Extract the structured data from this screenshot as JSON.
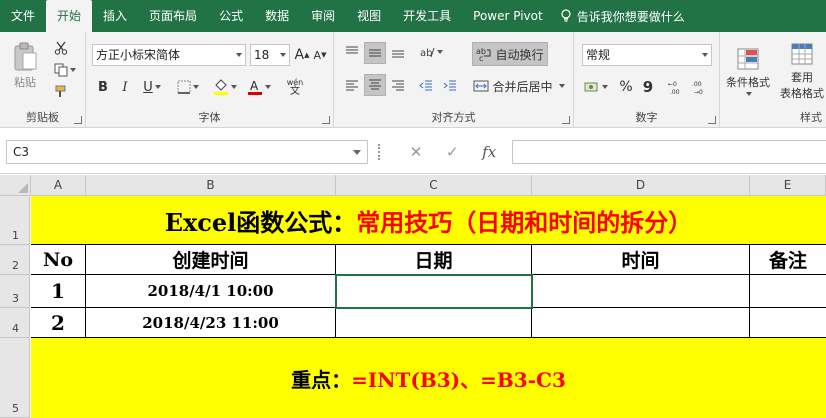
{
  "tabs": {
    "file": "文件",
    "home": "开始",
    "insert": "插入",
    "page_layout": "页面布局",
    "formulas": "公式",
    "data": "数据",
    "review": "审阅",
    "view": "视图",
    "developer": "开发工具",
    "power_pivot": "Power Pivot",
    "tell_me": "告诉我你想要做什么"
  },
  "ribbon": {
    "clipboard": {
      "paste_label": "粘贴",
      "group_label": "剪贴板"
    },
    "font": {
      "font_name": "方正小标宋简体",
      "font_size": "18",
      "bold": "B",
      "italic": "I",
      "underline": "U",
      "grow": "A",
      "shrink": "A",
      "wen": "wén",
      "group_label": "字体"
    },
    "alignment": {
      "wrap_text": "自动换行",
      "merge_center": "合并后居中",
      "group_label": "对齐方式"
    },
    "number": {
      "format": "常规",
      "group_label": "数字",
      "percent": "%",
      "comma": "9"
    },
    "styles": {
      "conditional": "条件格式",
      "table_format_1": "套用",
      "table_format_2": "表格格式",
      "group_label": "样式"
    }
  },
  "formula_bar": {
    "name_box": "C3",
    "fx": "fx",
    "formula": ""
  },
  "grid": {
    "columns": [
      "A",
      "B",
      "C",
      "D",
      "E"
    ],
    "rows": [
      "1",
      "2",
      "3",
      "4",
      "5"
    ],
    "title_black": "Excel函数公式：",
    "title_red": "常用技巧（日期和时间的拆分）",
    "headers": [
      "No",
      "创建时间",
      "日期",
      "时间",
      "备注"
    ],
    "data_rows": [
      {
        "no": "1",
        "created": "2018/4/1 10:00",
        "date": "",
        "time": "",
        "note": ""
      },
      {
        "no": "2",
        "created": "2018/4/23 11:00",
        "date": "",
        "time": "",
        "note": ""
      }
    ],
    "key_label": "重点：",
    "key_formula": "=INT(B3)、=B3-C3"
  },
  "colors": {
    "accent": "#217346",
    "highlight": "#ffff00",
    "red_text": "#ff0000"
  }
}
